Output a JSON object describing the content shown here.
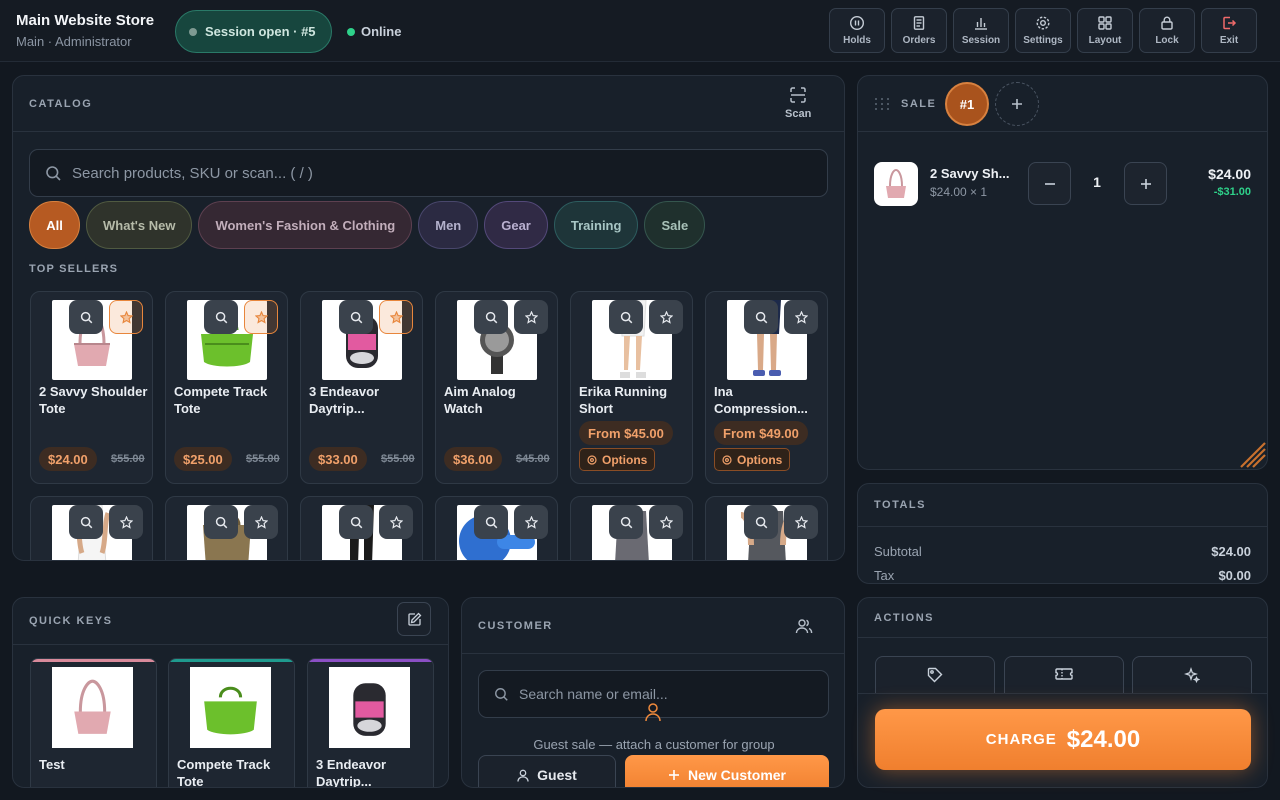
{
  "header": {
    "store_name": "Main Website Store",
    "store_sub": "Main · Administrator",
    "session_label": "Session open · #5",
    "status": "Online",
    "buttons": [
      "Holds",
      "Orders",
      "Session",
      "Settings",
      "Layout",
      "Lock",
      "Exit"
    ]
  },
  "catalog": {
    "title": "CATALOG",
    "scan_label": "Scan",
    "search_placeholder": "Search products, SKU or scan... ( / )",
    "categories": [
      {
        "label": "All",
        "color": "#b65a22"
      },
      {
        "label": "What's New",
        "color": "#5a6546"
      },
      {
        "label": "Women's Fashion & Clothing",
        "color": "#6a4655"
      },
      {
        "label": "Men",
        "color": "#4b4870"
      },
      {
        "label": "Gear",
        "color": "#5b4d77"
      },
      {
        "label": "Training",
        "color": "#2c6262"
      },
      {
        "label": "Sale",
        "color": "#3b5f55"
      }
    ],
    "section_label": "TOP SELLERS",
    "products": [
      {
        "name": "2 Savvy Shoulder Tote",
        "price": "$24.00",
        "old_price": "$55.00",
        "favorite": true
      },
      {
        "name": "Compete Track Tote",
        "price": "$25.00",
        "old_price": "$55.00",
        "favorite": true
      },
      {
        "name": "3 Endeavor Daytrip...",
        "price": "$33.00",
        "old_price": "$55.00",
        "favorite": true
      },
      {
        "name": "Aim Analog Watch",
        "price": "$36.00",
        "old_price": "$45.00",
        "favorite": false
      },
      {
        "name": "Erika Running Short",
        "price": "From $45.00",
        "options_label": "Options",
        "favorite": false
      },
      {
        "name": "Ina Compression...",
        "price": "From $49.00",
        "options_label": "Options",
        "favorite": false
      }
    ]
  },
  "sale": {
    "title": "SALE",
    "tab": "#1",
    "line": {
      "name": "2 Savvy Sh...",
      "unit": "$24.00 × 1",
      "qty": "1",
      "total": "$24.00",
      "discount": "-$31.00"
    }
  },
  "totals": {
    "title": "TOTALS",
    "rows": [
      {
        "label": "Subtotal",
        "value": "$24.00"
      },
      {
        "label": "Tax",
        "value": "$0.00"
      }
    ]
  },
  "quick_keys": {
    "title": "QUICK KEYS",
    "items": [
      {
        "name": "Test",
        "color": "#d98a9b"
      },
      {
        "name": "Compete Track Tote",
        "color": "#1f9a8e"
      },
      {
        "name": "3 Endeavor Daytrip...",
        "color": "#8b4fc4"
      }
    ]
  },
  "customer": {
    "title": "CUSTOMER",
    "search_placeholder": "Search name or email...",
    "hint": "Guest sale — attach a customer for group",
    "guest_label": "Guest",
    "new_label": "New Customer"
  },
  "actions": {
    "title": "ACTIONS",
    "charge_label": "CHARGE",
    "charge_amount": "$24.00"
  },
  "colors": {
    "accent": "#f08a3c",
    "success": "#2ed18a",
    "session": "#17463e"
  }
}
